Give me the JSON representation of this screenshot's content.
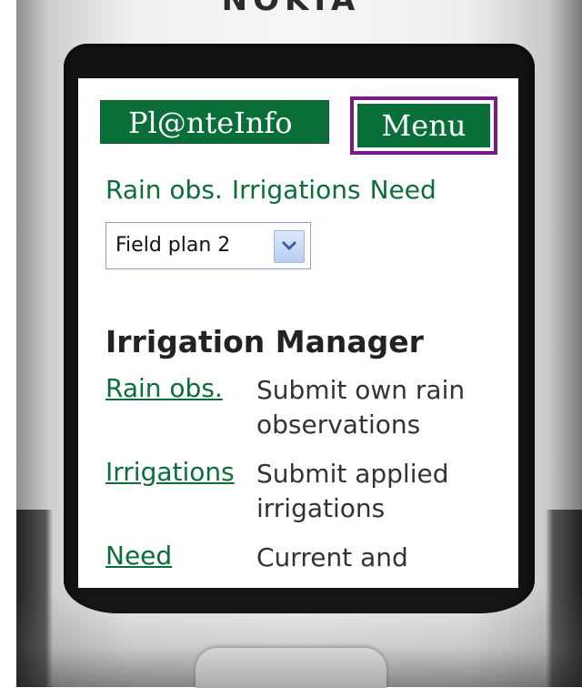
{
  "device": {
    "brand": "NOKIA"
  },
  "header": {
    "logo_label": "Pl@nteInfo",
    "menu_label": "Menu"
  },
  "quicklinks": [
    "Rain obs.",
    "Irrigations",
    "Need"
  ],
  "field_select": {
    "selected": "Field plan 2"
  },
  "section": {
    "title": "Irrigation Manager",
    "items": [
      {
        "link": "Rain obs.",
        "desc": "Submit own rain observations"
      },
      {
        "link": "Irrigations",
        "desc": "Submit applied irrigations"
      },
      {
        "link": "Need",
        "desc": "Current and"
      }
    ]
  },
  "colors": {
    "accent_green": "#0a6e38",
    "focus_purple": "#7a1a86"
  }
}
